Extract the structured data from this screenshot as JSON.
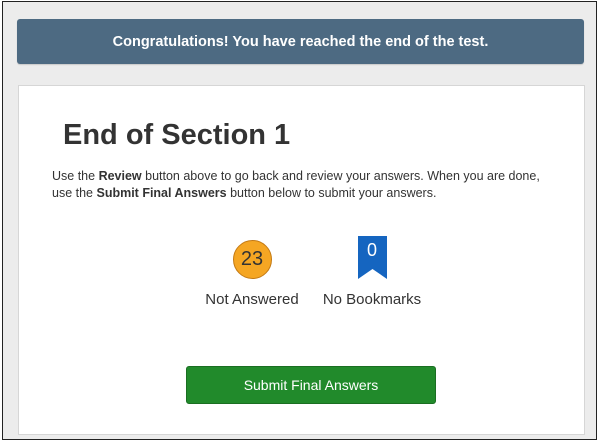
{
  "banner": {
    "message": "Congratulations! You have reached the end of the test."
  },
  "section": {
    "title": "End of Section 1",
    "instructions": {
      "part1": "Use the ",
      "bold1": "Review",
      "part2": " button above to go back and review your answers. When you are done, use the ",
      "bold2": "Submit Final Answers",
      "part3": " button below to submit your answers."
    }
  },
  "stats": {
    "not_answered": {
      "count": "23",
      "label": "Not Answered",
      "icon": "circle-badge-icon",
      "color": "#f5a623"
    },
    "bookmarks": {
      "count": "0",
      "label": "No Bookmarks",
      "icon": "bookmark-icon",
      "color": "#1565c0"
    }
  },
  "actions": {
    "submit_label": "Submit Final Answers",
    "submit_color": "#218a2b"
  },
  "theme": {
    "banner_color": "#4d6a82"
  }
}
